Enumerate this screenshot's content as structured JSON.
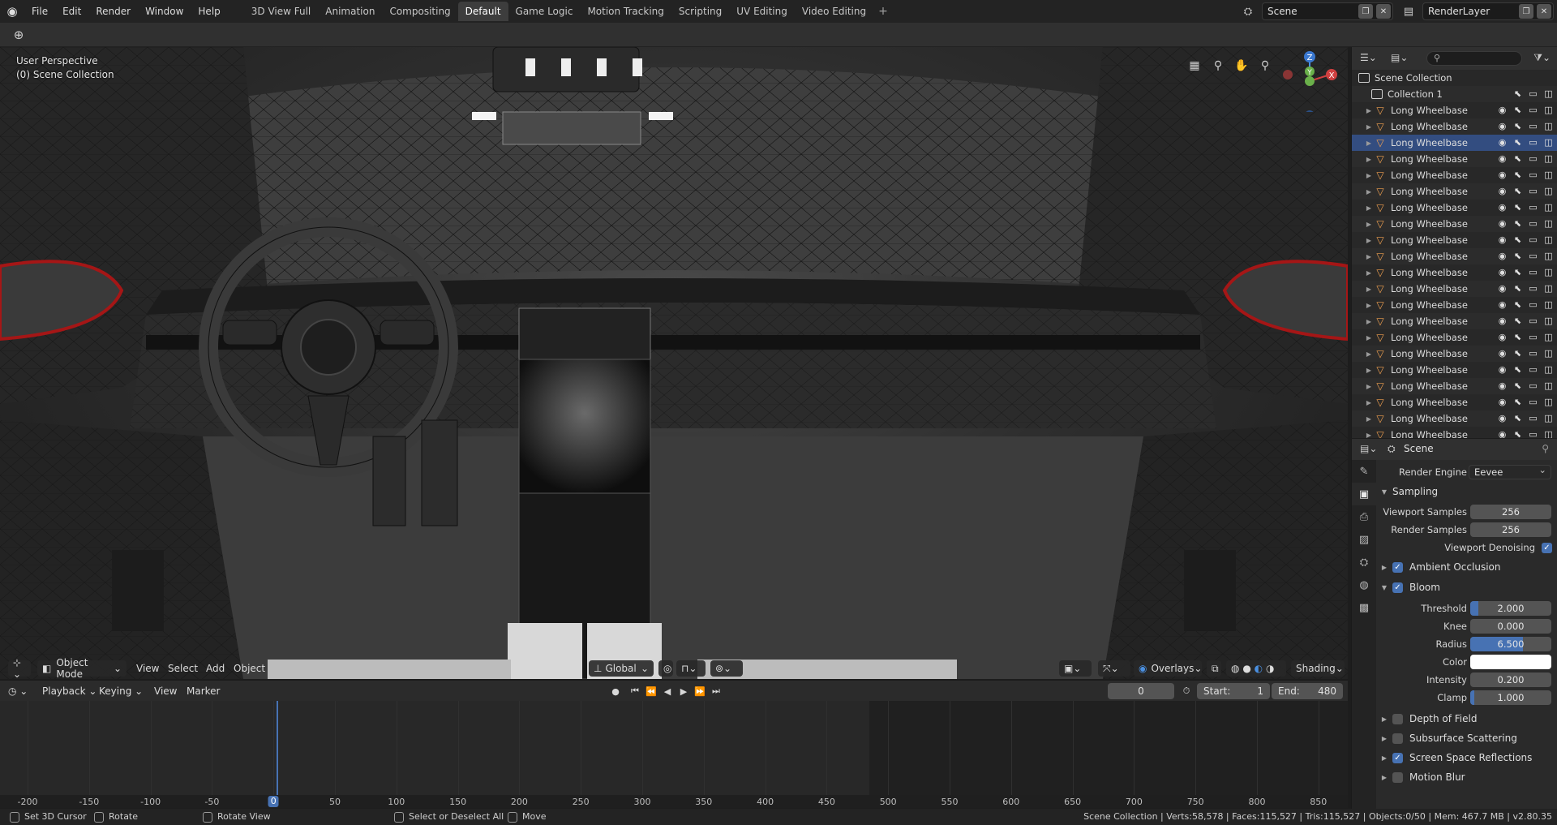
{
  "menu": [
    "File",
    "Edit",
    "Render",
    "Window",
    "Help"
  ],
  "workspaces": [
    "3D View Full",
    "Animation",
    "Compositing",
    "Default",
    "Game Logic",
    "Motion Tracking",
    "Scripting",
    "UV Editing",
    "Video Editing"
  ],
  "active_workspace": "Default",
  "workspace_add": "+",
  "scene_name": "Scene",
  "render_layer": "RenderLayer",
  "viewport": {
    "perspective": "User Perspective",
    "collection": "(0) Scene Collection",
    "gizmo": {
      "z": "Z",
      "y": "Y",
      "x": "X"
    }
  },
  "viewport_header": {
    "mode": "Object Mode",
    "menus": [
      "View",
      "Select",
      "Add",
      "Object"
    ],
    "transform_orientation": "Global",
    "overlays": "Overlays",
    "shading": "Shading"
  },
  "timeline": {
    "menus": [
      "Playback",
      "Keying",
      "View",
      "Marker"
    ],
    "current_frame": "0",
    "start_label": "Start:",
    "start": "1",
    "end_label": "End:",
    "end": "480",
    "ticks": [
      "-200",
      "-150",
      "-100",
      "-50",
      "0",
      "50",
      "100",
      "150",
      "200",
      "250",
      "300",
      "350",
      "400",
      "450",
      "500",
      "550",
      "600",
      "650",
      "700",
      "750",
      "800",
      "850"
    ]
  },
  "statusbar": {
    "items": [
      "Set 3D Cursor",
      "Rotate",
      "Rotate View",
      "Select or Deselect All",
      "Move"
    ],
    "info": "Scene Collection | Verts:58,578 | Faces:115,527 | Tris:115,527 | Objects:0/50 | Mem: 467.7 MB | v2.80.35"
  },
  "outliner": {
    "root": "Scene Collection",
    "collection": "Collection 1",
    "object_name": "Long Wheelbase Car",
    "row_count": 21,
    "selected_index": 2
  },
  "properties": {
    "context": "Scene",
    "render_engine_label": "Render Engine",
    "render_engine": "Eevee",
    "sampling": {
      "title": "Sampling",
      "viewport_samples_label": "Viewport Samples",
      "viewport_samples": "256",
      "render_samples_label": "Render Samples",
      "render_samples": "256",
      "viewport_denoising_label": "Viewport Denoising"
    },
    "ambient_occlusion": "Ambient Occlusion",
    "bloom": {
      "title": "Bloom",
      "threshold_label": "Threshold",
      "threshold": "2.000",
      "threshold_fill": 0.1,
      "knee_label": "Knee",
      "knee": "0.000",
      "knee_fill": 0,
      "radius_label": "Radius",
      "radius": "6.500",
      "radius_fill": 0.65,
      "color_label": "Color",
      "color": "#ffffff",
      "intensity_label": "Intensity",
      "intensity": "0.200",
      "intensity_fill": 0,
      "clamp_label": "Clamp",
      "clamp": "1.000",
      "clamp_fill": 0.05
    },
    "depth_of_field": "Depth of Field",
    "subsurface_scattering": "Subsurface Scattering",
    "screen_space_reflections": "Screen Space Reflections",
    "motion_blur": "Motion Blur"
  },
  "colors": {
    "accent": "#4772b3",
    "selected_row": "#334d80",
    "object_icon": "#f0a050"
  }
}
